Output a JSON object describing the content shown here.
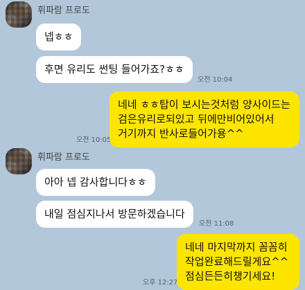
{
  "conversation": {
    "groups": [
      {
        "sender": "휘파람 프로도"
      },
      {
        "sender": "휘파람 프로도"
      }
    ],
    "messages": [
      {
        "text": "넵ㅎㅎ",
        "direction": "received"
      },
      {
        "text": "후면 유리도 썬팅 들어가죠?ㅎㅎ",
        "direction": "received",
        "time": "오전 10:04"
      },
      {
        "lines": [
          "네네 ㅎㅎ탑이 보시는것처럼 양사이드는",
          "검은유리로되있고 뒤에만비어있어서",
          "거기까지 반사로들어가용^^"
        ],
        "direction": "sent",
        "time": "오전 10:05"
      },
      {
        "text": "아아 넵 감사합니다ㅎㅎ",
        "direction": "received"
      },
      {
        "text": "내일 점심지나서 방문하겠습니다",
        "direction": "received",
        "time": "오전 11:08"
      },
      {
        "lines": [
          "네네 마지막까지 꼼꼼히",
          "작업완료해드릴게요^^",
          "점심든든히챙기세요!"
        ],
        "direction": "sent",
        "time": "오후 12:27"
      }
    ],
    "colors": {
      "background": "#b2c7d9",
      "received_bubble": "#ffffff",
      "sent_bubble": "#fee500"
    }
  }
}
